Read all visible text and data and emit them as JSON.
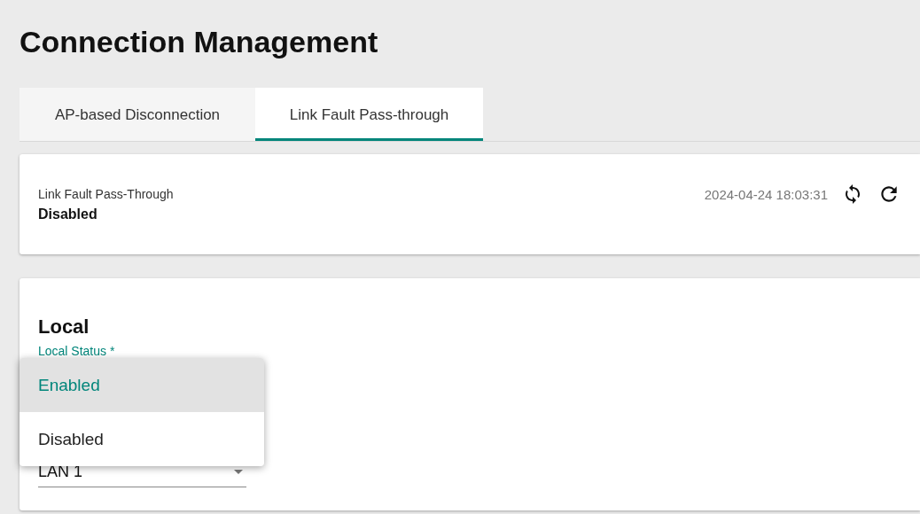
{
  "page": {
    "title": "Connection Management"
  },
  "tabs": [
    {
      "label": "AP-based Disconnection",
      "selected": false
    },
    {
      "label": "Link Fault Pass-through",
      "selected": true
    }
  ],
  "status_card": {
    "label": "Link Fault Pass-Through",
    "value": "Disabled",
    "timestamp": "2024-04-24 18:03:31"
  },
  "settings_card": {
    "section_title": "Local",
    "status_field": {
      "label": "Local Status *"
    },
    "port_field": {
      "value": "LAN 1"
    }
  },
  "dropdown_menu": [
    {
      "label": "Enabled",
      "selected": true
    },
    {
      "label": "Disabled",
      "selected": false
    }
  ]
}
